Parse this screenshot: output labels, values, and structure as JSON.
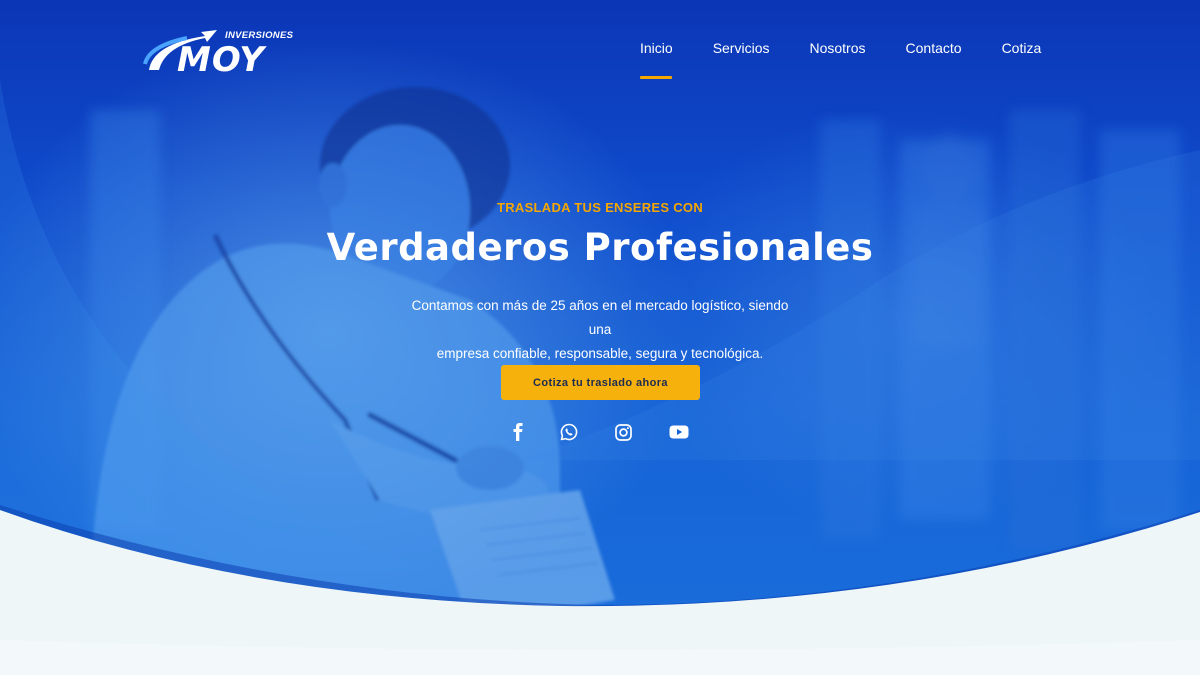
{
  "brand": {
    "name": "MOY",
    "tagline": "INVERSIONES"
  },
  "nav": {
    "items": [
      {
        "label": "Inicio",
        "active": true
      },
      {
        "label": "Servicios",
        "active": false
      },
      {
        "label": "Nosotros",
        "active": false
      },
      {
        "label": "Contacto",
        "active": false
      },
      {
        "label": "Cotiza",
        "active": false
      }
    ]
  },
  "hero": {
    "eyebrow": "TRASLADA TUS ENSERES CON",
    "headline": "Verdaderos Profesionales",
    "description_line1": "Contamos con más de 25 años en el mercado logístico, siendo una",
    "description_line2": "empresa confiable, responsable, segura y tecnológica.",
    "cta_label": "Cotiza tu traslado ahora"
  },
  "socials": [
    {
      "icon": "facebook-icon"
    },
    {
      "icon": "whatsapp-icon"
    },
    {
      "icon": "instagram-icon"
    },
    {
      "icon": "youtube-icon"
    }
  ],
  "colors": {
    "primary_blue": "#0f4ccc",
    "accent_yellow": "#f7b10d",
    "eyebrow_orange": "#f5a700",
    "section_bg": "#eef6f8"
  }
}
